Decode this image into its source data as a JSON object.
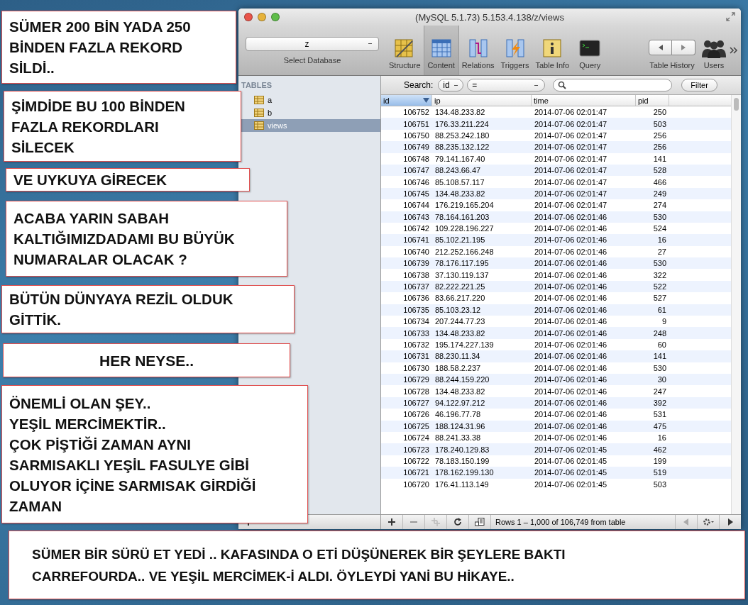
{
  "window": {
    "title": "(MySQL 5.1.73) 5.153.4.138/z/views"
  },
  "toolbar": {
    "database": {
      "value": "z",
      "label": "Select Database"
    },
    "items": [
      {
        "kind": "structure",
        "label": "Structure",
        "selected": false
      },
      {
        "kind": "content",
        "label": "Content",
        "selected": true
      },
      {
        "kind": "relations",
        "label": "Relations",
        "selected": false
      },
      {
        "kind": "triggers",
        "label": "Triggers",
        "selected": false
      },
      {
        "kind": "info",
        "label": "Table Info",
        "selected": false
      },
      {
        "kind": "query",
        "label": "Query",
        "selected": false
      }
    ],
    "history_label": "Table History",
    "users_label": "Users"
  },
  "sidebar": {
    "header": "TABLES",
    "tables": [
      {
        "name": "a",
        "selected": false
      },
      {
        "name": "b",
        "selected": false
      },
      {
        "name": "views",
        "selected": true
      }
    ]
  },
  "search": {
    "label": "Search:",
    "field": "id",
    "operator": "=",
    "button": "Filter"
  },
  "table": {
    "columns": [
      {
        "label": "id",
        "selected": true
      },
      {
        "label": "ip",
        "selected": false
      },
      {
        "label": "time",
        "selected": false
      },
      {
        "label": "pid",
        "selected": false
      }
    ],
    "rows": [
      [
        "106752",
        "134.48.233.82",
        "2014-07-06 02:01:47",
        "250"
      ],
      [
        "106751",
        "176.33.211.224",
        "2014-07-06 02:01:47",
        "503"
      ],
      [
        "106750",
        "88.253.242.180",
        "2014-07-06 02:01:47",
        "256"
      ],
      [
        "106749",
        "88.235.132.122",
        "2014-07-06 02:01:47",
        "256"
      ],
      [
        "106748",
        "79.141.167.40",
        "2014-07-06 02:01:47",
        "141"
      ],
      [
        "106747",
        "88.243.66.47",
        "2014-07-06 02:01:47",
        "528"
      ],
      [
        "106746",
        "85.108.57.117",
        "2014-07-06 02:01:47",
        "466"
      ],
      [
        "106745",
        "134.48.233.82",
        "2014-07-06 02:01:47",
        "249"
      ],
      [
        "106744",
        "176.219.165.204",
        "2014-07-06 02:01:47",
        "274"
      ],
      [
        "106743",
        "78.164.161.203",
        "2014-07-06 02:01:46",
        "530"
      ],
      [
        "106742",
        "109.228.196.227",
        "2014-07-06 02:01:46",
        "524"
      ],
      [
        "106741",
        "85.102.21.195",
        "2014-07-06 02:01:46",
        "16"
      ],
      [
        "106740",
        "212.252.166.248",
        "2014-07-06 02:01:46",
        "27"
      ],
      [
        "106739",
        "78.176.117.195",
        "2014-07-06 02:01:46",
        "530"
      ],
      [
        "106738",
        "37.130.119.137",
        "2014-07-06 02:01:46",
        "322"
      ],
      [
        "106737",
        "82.222.221.25",
        "2014-07-06 02:01:46",
        "522"
      ],
      [
        "106736",
        "83.66.217.220",
        "2014-07-06 02:01:46",
        "527"
      ],
      [
        "106735",
        "85.103.23.12",
        "2014-07-06 02:01:46",
        "61"
      ],
      [
        "106734",
        "207.244.77.23",
        "2014-07-06 02:01:46",
        "9"
      ],
      [
        "106733",
        "134.48.233.82",
        "2014-07-06 02:01:46",
        "248"
      ],
      [
        "106732",
        "195.174.227.139",
        "2014-07-06 02:01:46",
        "60"
      ],
      [
        "106731",
        "88.230.11.34",
        "2014-07-06 02:01:46",
        "141"
      ],
      [
        "106730",
        "188.58.2.237",
        "2014-07-06 02:01:46",
        "530"
      ],
      [
        "106729",
        "88.244.159.220",
        "2014-07-06 02:01:46",
        "30"
      ],
      [
        "106728",
        "134.48.233.82",
        "2014-07-06 02:01:46",
        "247"
      ],
      [
        "106727",
        "94.122.97.212",
        "2014-07-06 02:01:46",
        "392"
      ],
      [
        "106726",
        "46.196.77.78",
        "2014-07-06 02:01:46",
        "531"
      ],
      [
        "106725",
        "188.124.31.96",
        "2014-07-06 02:01:46",
        "475"
      ],
      [
        "106724",
        "88.241.33.38",
        "2014-07-06 02:01:46",
        "16"
      ],
      [
        "106723",
        "178.240.129.83",
        "2014-07-06 02:01:45",
        "462"
      ],
      [
        "106722",
        "78.183.150.199",
        "2014-07-06 02:01:45",
        "199"
      ],
      [
        "106721",
        "178.162.199.130",
        "2014-07-06 02:01:45",
        "519"
      ],
      [
        "106720",
        "176.41.113.149",
        "2014-07-06 02:01:45",
        "503"
      ]
    ]
  },
  "status_bar": "Rows 1 – 1,000 of 106,749 from table",
  "annotations": [
    {
      "kind": "left",
      "text": "SÜMER 200 BİN YADA 250\nBİNDEN FAZLA REKORD\nSİLDİ.."
    },
    {
      "kind": "left",
      "text": "ŞİMDİDE BU 100 BİNDEN\nFAZLA REKORDLARI\nSİLECEK"
    },
    {
      "kind": "left",
      "text": "VE UYKUYA GİRECEK"
    },
    {
      "kind": "left",
      "text": "ACABA YARIN SABAH\nKALTIĞIMIZDADAMI BU BÜYÜK\nNUMARALAR OLACAK ?"
    },
    {
      "kind": "left",
      "text": "BÜTÜN DÜNYAYA REZİL OLDUK\nGİTTİK."
    },
    {
      "kind": "center",
      "text": "HER NEYSE.."
    },
    {
      "kind": "left",
      "text": "ÖNEMLİ OLAN ŞEY..\nYEŞİL MERCİMEKTİR..\nÇOK PİŞTİĞİ ZAMAN AYNI\nSARMISAKLI YEŞİL FASULYE GİBİ\nOLUYOR İÇİNE SARMISAK GİRDİĞİ\nZAMAN"
    },
    {
      "kind": "wide",
      "text": "SÜMER BİR SÜRÜ ET YEDİ .. KAFASINDA O ETİ DÜŞÜNEREK BİR ŞEYLERE BAKTI\nCARREFOURDA.. VE YEŞİL MERCİMEK-İ ALDI. ÖYLEYDİ YANİ BU HİKAYE.."
    }
  ]
}
